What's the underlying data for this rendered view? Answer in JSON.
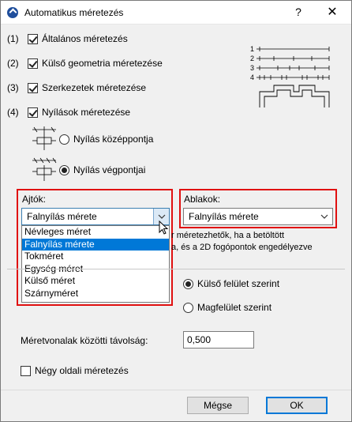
{
  "window": {
    "title": "Automatikus méretezés",
    "help_label": "?",
    "close_label": "✕"
  },
  "options": [
    {
      "num": "(1)",
      "label": "Általános méretezés",
      "checked": true
    },
    {
      "num": "(2)",
      "label": "Külső geometria méretezése",
      "checked": true
    },
    {
      "num": "(3)",
      "label": "Szerkezetek méretezése",
      "checked": true
    },
    {
      "num": "(4)",
      "label": "Nyílások méretezése",
      "checked": true
    }
  ],
  "preview": {
    "labels": [
      "1",
      "2",
      "3",
      "4"
    ]
  },
  "opening_reference": {
    "center_label": "Nyílás középpontja",
    "center_checked": false,
    "endpoints_label": "Nyílás végpontjai",
    "endpoints_checked": true
  },
  "doors": {
    "label": "Ajtók:",
    "selected": "Falnyílás mérete",
    "options": [
      "Névleges méret",
      "Falnyílás mérete",
      "Tokméret",
      "Egység méret",
      "Külső méret",
      "Szárnyméret"
    ],
    "selected_index": 1
  },
  "windows": {
    "label": "Ablakok:",
    "selected": "Falnyílás mérete"
  },
  "info": {
    "line1": "r méretezhetők, ha a betöltött",
    "line2": "a, és a 2D fogópontok engedélyezve"
  },
  "surface": {
    "outer_label": "Külső felület szerint",
    "outer_checked": true,
    "core_label": "Magfelület szerint",
    "core_checked": false
  },
  "spacing": {
    "label": "Méretvonalak közötti távolság:",
    "value": "0,500"
  },
  "four_sided": {
    "label": "Négy oldali méretezés",
    "checked": false
  },
  "buttons": {
    "cancel": "Mégse",
    "ok": "OK"
  },
  "colors": {
    "highlight_border": "#e01010",
    "selection": "#0078d7"
  }
}
